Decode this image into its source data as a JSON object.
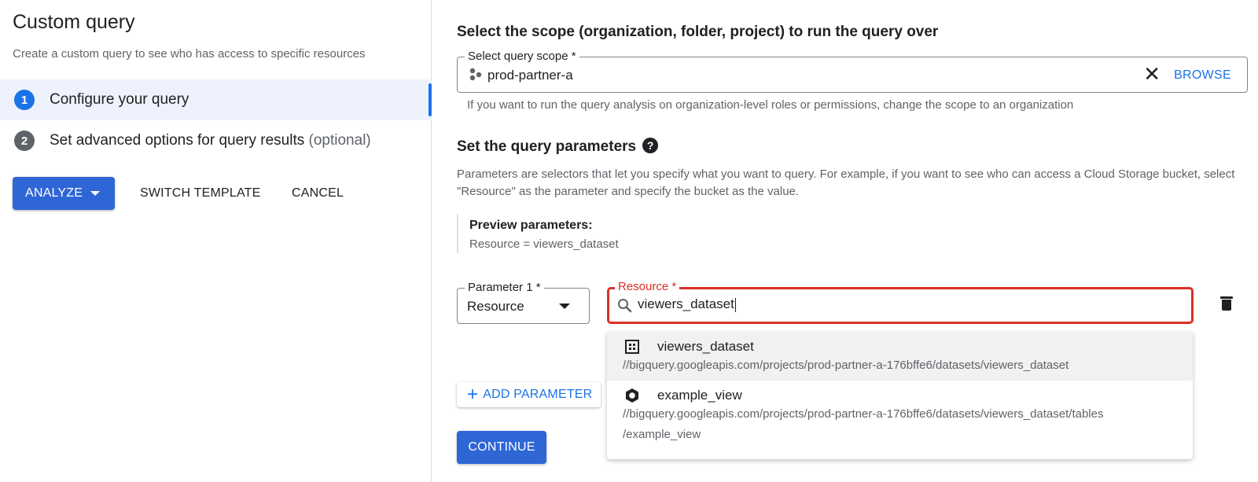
{
  "sidebar": {
    "title": "Custom query",
    "subtitle": "Create a custom query to see who has access to specific resources",
    "steps": [
      {
        "number": "1",
        "label": "Configure your query",
        "optional": "",
        "active": true
      },
      {
        "number": "2",
        "label": "Set advanced options for query results",
        "optional": "(optional)",
        "active": false
      }
    ],
    "analyze_label": "ANALYZE",
    "switch_template_label": "SWITCH TEMPLATE",
    "cancel_label": "CANCEL"
  },
  "scope": {
    "heading": "Select the scope (organization, folder, project) to run the query over",
    "field_label": "Select query scope *",
    "value": "prod-partner-a",
    "clear_icon": "close-icon",
    "browse_label": "BROWSE",
    "hint": "If you want to run the query analysis on organization-level roles or permissions, change the scope to an organization"
  },
  "params": {
    "heading": "Set the query parameters",
    "help_icon": "help-icon",
    "description": "Parameters are selectors that let you specify what you want to query. For example, if you want to see who can access a Cloud Storage bucket, select \"Resource\" as the parameter and specify the bucket as the value.",
    "preview_title": "Preview parameters:",
    "preview_value": "Resource = viewers_dataset",
    "param1_label": "Parameter 1 *",
    "param1_value": "Resource",
    "resource_label": "Resource *",
    "resource_value": "viewers_dataset",
    "add_parameter_label": "ADD PARAMETER",
    "continue_label": "CONTINUE",
    "accent_color": "#1a73e8",
    "error_color": "#d93025"
  },
  "suggestions": [
    {
      "name": "viewers_dataset",
      "icon": "dataset-icon",
      "path_lines": [
        "//bigquery.googleapis.com/projects/prod-partner-a-176bffe6/datasets/viewers_dataset"
      ]
    },
    {
      "name": "example_view",
      "icon": "view-icon",
      "path_lines": [
        "//bigquery.googleapis.com/projects/prod-partner-a-176bffe6/datasets/viewers_dataset/tables",
        "/example_view"
      ]
    }
  ]
}
